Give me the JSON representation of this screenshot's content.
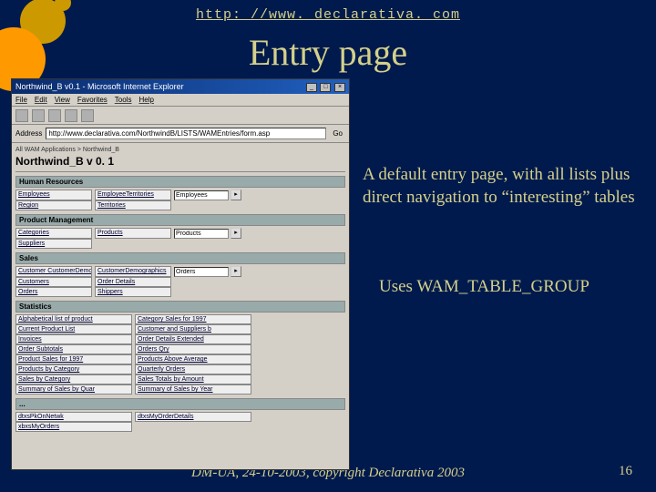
{
  "url": "http: //www. declarativa. com",
  "title": "Entry page",
  "body1": "A default entry page, with all lists plus direct navigation to “interesting” tables",
  "body2": "Uses WAM_TABLE_GROUP",
  "footer": "DM-UA, 24-10-2003, copyright Declarativa 2003",
  "pagenum": "16",
  "browser": {
    "title": "Northwind_B v0.1 - Microsoft Internet Explorer",
    "menu": [
      "File",
      "Edit",
      "View",
      "Favorites",
      "Tools",
      "Help"
    ],
    "addr_label": "Address",
    "addr_value": "http://www.declarativa.com/NorthwindB/LISTS/WAMEntries/form.asp",
    "go_label": "Go",
    "breadcrumb": "All WAM Applications > Northwind_B",
    "app_title": "Northwind_B v 0. 1",
    "sections": {
      "hr": {
        "header": "Human Resources",
        "items": [
          "Employees",
          "EmployeeTerritories"
        ],
        "nav": "Employees"
      },
      "hr2": {
        "items": [
          "Region",
          "Territories"
        ]
      },
      "pm": {
        "header": "Product Management",
        "items": [
          "Categories",
          "Products"
        ],
        "nav": "Products"
      },
      "pm2": {
        "items": [
          "Suppliers"
        ]
      },
      "sales": {
        "header": "Sales",
        "row1": [
          "Customer CustomerDemo",
          "CustomerDemographics"
        ],
        "nav": "Orders",
        "row2": [
          "Customers",
          "Order Details"
        ],
        "row3": [
          "Orders",
          "Shippers"
        ]
      },
      "stats": {
        "header": "Statistics",
        "rows": [
          [
            "Alphabetical list of product",
            "Category Sales for 1997"
          ],
          [
            "Current Product List",
            "Customer and Suppliers b"
          ],
          [
            "Invoices",
            "Order Details Extended"
          ],
          [
            "Order Subtotals",
            "Orders Qry"
          ],
          [
            "Product Sales for 1997",
            "Products Above Average"
          ],
          [
            "Products by Category",
            "Quarterly Orders"
          ],
          [
            "Sales by Category",
            "Sales Totals by Amount"
          ],
          [
            "Summary of Sales by Quar",
            "Summary of Sales by Year"
          ]
        ]
      },
      "misc": {
        "header": "...",
        "rows": [
          [
            "dtxsPkOnNetwk",
            "dtxsMyOrderDetails"
          ],
          [
            "xbxsMyOrders"
          ]
        ]
      }
    }
  }
}
